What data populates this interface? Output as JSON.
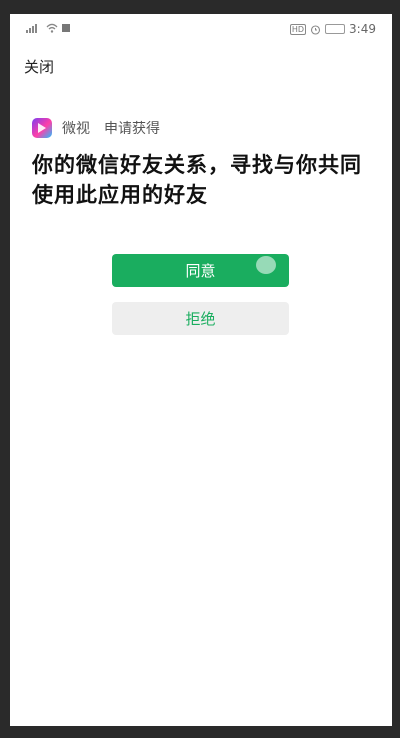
{
  "status_bar": {
    "time": "3:49",
    "hd_label": "HD",
    "icons": [
      "signal-icon",
      "wifi-icon",
      "notification-square-icon",
      "hd-icon",
      "alarm-icon",
      "battery-icon"
    ]
  },
  "header": {
    "close_label": "关闭"
  },
  "app": {
    "name": "微视",
    "request_label": "申请获得"
  },
  "permission": {
    "description": "你的微信好友关系，寻找与你共同使用此应用的好友"
  },
  "buttons": {
    "agree_label": "同意",
    "reject_label": "拒绝"
  },
  "colors": {
    "accent_green": "#1aad5f",
    "reject_bg": "#eeeeee",
    "frame": "#2a2a2a"
  }
}
